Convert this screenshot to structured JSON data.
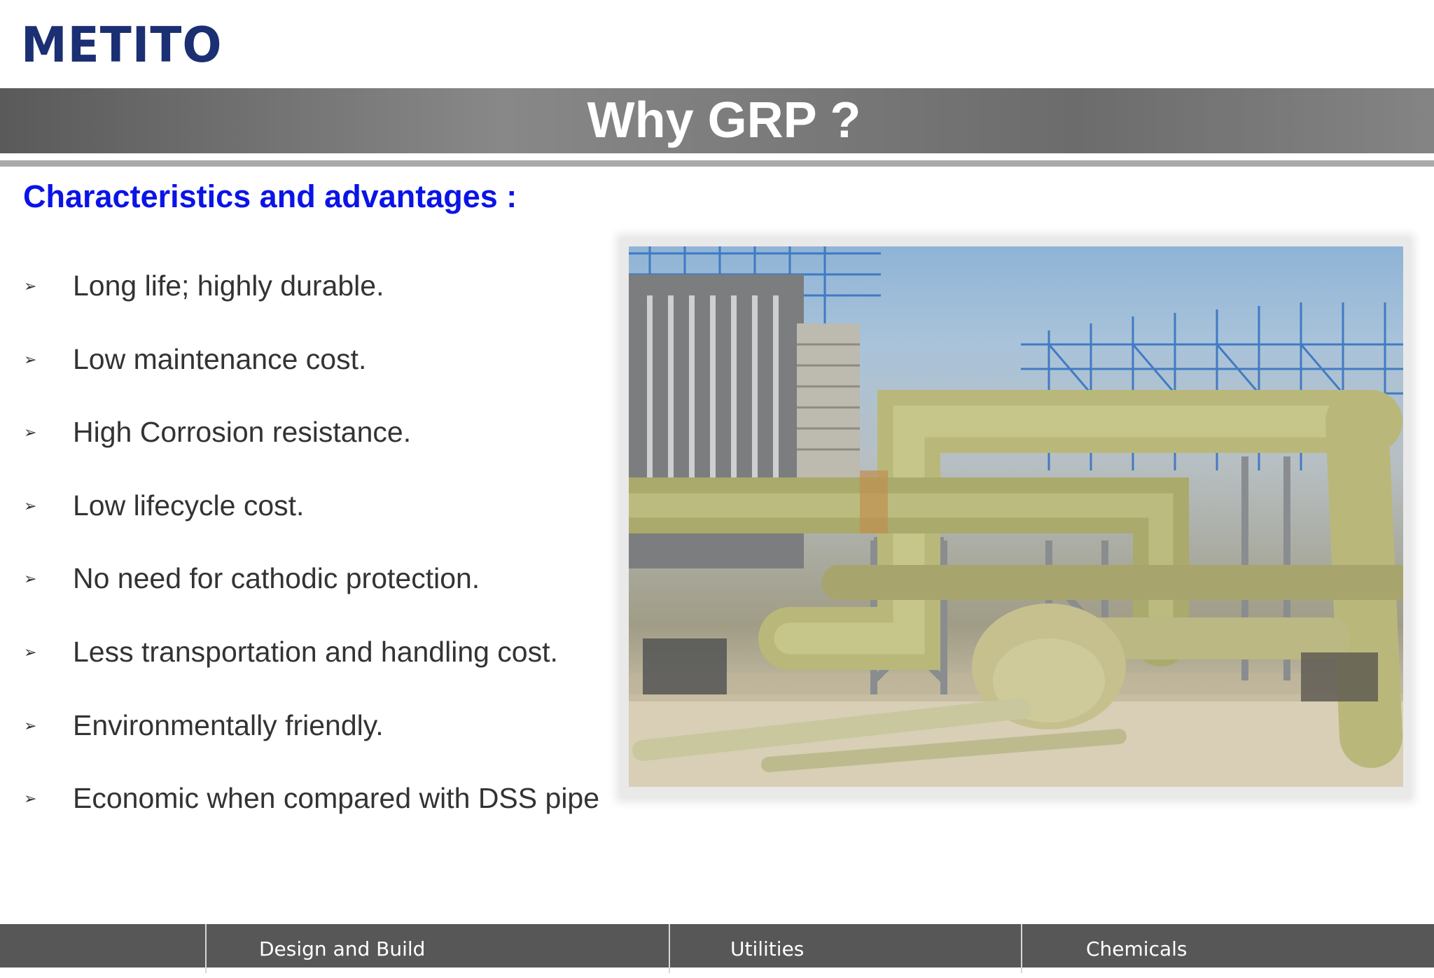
{
  "logo": {
    "text": "METITO"
  },
  "header": {
    "title": "Why GRP ?"
  },
  "subtitle": "Characteristics and advantages :",
  "bullets": [
    {
      "text": "Long life; highly durable."
    },
    {
      "text": "Low maintenance cost."
    },
    {
      "text": "High Corrosion resistance."
    },
    {
      "text": "Low lifecycle cost."
    },
    {
      "text": "No need for cathodic protection."
    },
    {
      "text": "Less transportation and handling cost."
    },
    {
      "text": "Environmentally friendly."
    },
    {
      "text": "Economic when compared with DSS pipe"
    }
  ],
  "bullet_icon": "arrowhead-bullet-icon",
  "footer": {
    "items": [
      {
        "label": "Design and Build"
      },
      {
        "label": "Utilities"
      },
      {
        "label": "Chemicals"
      }
    ]
  },
  "colors": {
    "logo": "#1b2f73",
    "subtitle": "#0a14e6",
    "title_bar": "#787878",
    "footer": "#575757",
    "body_text": "#333333"
  }
}
